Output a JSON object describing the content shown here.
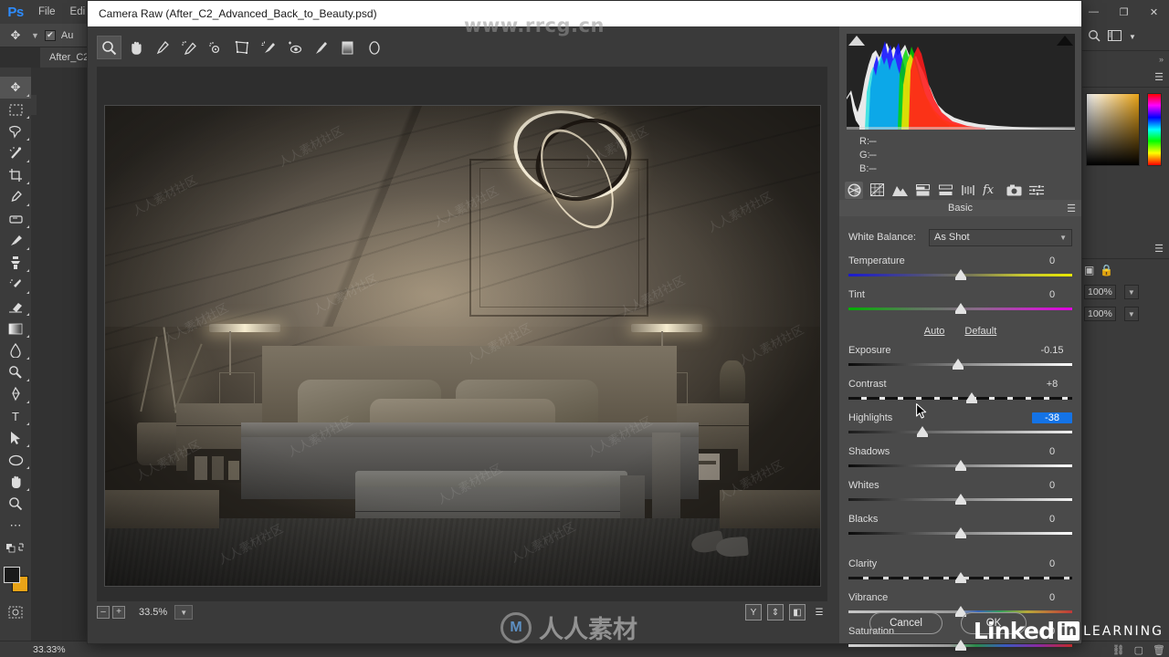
{
  "photoshop": {
    "logo": "Ps",
    "menus": [
      "File",
      "Edi"
    ],
    "window_buttons": [
      "—",
      "❐",
      "✕"
    ],
    "options_bar": {
      "auto_label": "Au",
      "checked": true
    },
    "document_tab": "After_C2_",
    "tools": [
      {
        "name": "move-tool",
        "glyph": "✥",
        "active": true
      },
      {
        "name": "marquee-tool",
        "glyph": "▭"
      },
      {
        "name": "lasso-tool",
        "glyph": "⊿"
      },
      {
        "name": "magic-wand-tool",
        "glyph": "✨"
      },
      {
        "name": "crop-tool",
        "glyph": "⌗"
      },
      {
        "name": "eyedropper-tool",
        "glyph": "✒"
      },
      {
        "name": "healing-brush-tool",
        "glyph": "▰"
      },
      {
        "name": "brush-tool",
        "glyph": "🖌"
      },
      {
        "name": "clone-stamp-tool",
        "glyph": "⎙"
      },
      {
        "name": "history-brush-tool",
        "glyph": "✎"
      },
      {
        "name": "eraser-tool",
        "glyph": "▱"
      },
      {
        "name": "gradient-tool",
        "glyph": "▤"
      },
      {
        "name": "blur-tool",
        "glyph": "◗"
      },
      {
        "name": "dodge-tool",
        "glyph": "◍"
      },
      {
        "name": "pen-tool",
        "glyph": "✐"
      },
      {
        "name": "type-tool",
        "glyph": "T"
      },
      {
        "name": "path-selection-tool",
        "glyph": "➤"
      },
      {
        "name": "ellipse-tool",
        "glyph": "◯"
      },
      {
        "name": "hand-tool",
        "glyph": "✋"
      },
      {
        "name": "zoom-tool",
        "glyph": "🔍"
      },
      {
        "name": "more-tools",
        "glyph": "⋯"
      }
    ],
    "right_dock": {
      "opacity_value": "100%",
      "fill_value": "100%"
    },
    "status": {
      "zoom": "33.33%",
      "doc_info": ""
    }
  },
  "camera_raw": {
    "title": "Camera Raw (After_C2_Advanced_Back_to_Beauty.psd)",
    "toolbar": [
      {
        "name": "zoom-tool",
        "active": true
      },
      {
        "name": "hand-tool",
        "active": false
      },
      {
        "name": "white-balance-tool",
        "active": false
      },
      {
        "name": "color-sampler-tool",
        "active": false
      },
      {
        "name": "targeted-adjustment-tool",
        "active": false
      },
      {
        "name": "transform-tool",
        "active": false
      },
      {
        "name": "spot-removal-tool",
        "active": false
      },
      {
        "name": "red-eye-removal-tool",
        "active": false
      },
      {
        "name": "adjustment-brush-tool",
        "active": false
      },
      {
        "name": "graduated-filter-tool",
        "active": false
      },
      {
        "name": "radial-filter-tool",
        "active": false
      }
    ],
    "preview_toggle_name": "preview-toggle",
    "zoom": {
      "minus": "–",
      "plus": "+",
      "level": "33.5%"
    },
    "bottom_right_buttons": [
      "Y",
      "⇕",
      "◧",
      "☰"
    ],
    "histogram": {
      "shadow_clipping_name": "shadow-clipping-warning",
      "highlight_clipping_name": "highlight-clipping-warning"
    },
    "readout": {
      "r_label": "R:",
      "r_value": "---",
      "g_label": "G:",
      "g_value": "---",
      "b_label": "B:",
      "b_value": "---"
    },
    "panel_tabs": [
      {
        "name": "basic-tab",
        "active": true
      },
      {
        "name": "tone-curve-tab",
        "active": false
      },
      {
        "name": "detail-tab",
        "active": false
      },
      {
        "name": "hsl-grayscale-tab",
        "active": false
      },
      {
        "name": "split-toning-tab",
        "active": false
      },
      {
        "name": "lens-corrections-tab",
        "active": false
      },
      {
        "name": "effects-tab",
        "active": false
      },
      {
        "name": "camera-calibration-tab",
        "active": false
      },
      {
        "name": "presets-tab",
        "active": false
      }
    ],
    "panel_title": "Basic",
    "white_balance": {
      "label": "White Balance:",
      "value": "As Shot"
    },
    "auto_label": "Auto",
    "default_label": "Default",
    "sliders": [
      {
        "name": "Temperature",
        "value": "0",
        "pos": 50,
        "track": "tr-temp",
        "selected": false
      },
      {
        "name": "Tint",
        "value": "0",
        "pos": 50,
        "track": "tr-tint",
        "selected": false
      },
      {
        "name": "Exposure",
        "value": "-0.15",
        "pos": 49,
        "track": "tr-gray",
        "selected": false
      },
      {
        "name": "Contrast",
        "value": "+8",
        "pos": 55,
        "track": "tr-contrast",
        "selected": false
      },
      {
        "name": "Highlights",
        "value": "-38",
        "pos": 33,
        "track": "tr-gray2",
        "selected": true
      },
      {
        "name": "Shadows",
        "value": "0",
        "pos": 50,
        "track": "tr-gray",
        "selected": false
      },
      {
        "name": "Whites",
        "value": "0",
        "pos": 50,
        "track": "tr-gray2",
        "selected": false
      },
      {
        "name": "Blacks",
        "value": "0",
        "pos": 50,
        "track": "tr-gray",
        "selected": false
      },
      {
        "name": "Clarity",
        "value": "0",
        "pos": 50,
        "track": "tr-clarity",
        "selected": false
      },
      {
        "name": "Vibrance",
        "value": "0",
        "pos": 50,
        "track": "tr-vibrance",
        "selected": false
      },
      {
        "name": "Saturation",
        "value": "0",
        "pos": 50,
        "track": "tr-sat",
        "selected": false
      }
    ],
    "buttons": {
      "cancel": "Cancel",
      "ok": "OK"
    }
  },
  "watermarks": {
    "top_url": "www.rrcg.cn",
    "center_text": "人人素材",
    "center_logo": "M",
    "tile_text": "人人素材社区",
    "linkedin_word": "Linked",
    "linkedin_in": "in",
    "linkedin_learning": "LEARNING"
  },
  "colors": {
    "accent_blue": "#1473e6",
    "ps_blue": "#2d8cff",
    "panel_bg": "#4a4a4a",
    "app_bg": "#323232"
  }
}
